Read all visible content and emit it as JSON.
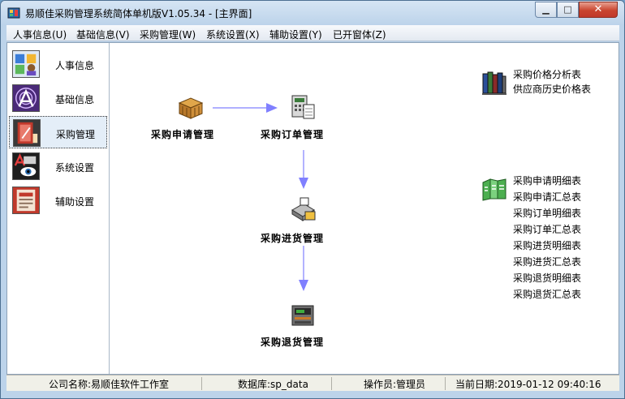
{
  "window": {
    "title": "易顺佳采购管理系统简体单机版V1.05.34 - [主界面]",
    "controls": {
      "minimize": "▁",
      "maximize": "□",
      "close": "✕"
    }
  },
  "menu": [
    {
      "label": "人事信息(U)"
    },
    {
      "label": "基础信息(V)"
    },
    {
      "label": "采购管理(W)"
    },
    {
      "label": "系统设置(X)"
    },
    {
      "label": "辅助设置(Y)"
    },
    {
      "label": "已开窗体(Z)"
    }
  ],
  "sidebar": {
    "items": [
      {
        "label": "人事信息",
        "icon": "people-icon",
        "active": false
      },
      {
        "label": "基础信息",
        "icon": "radar-icon",
        "active": false
      },
      {
        "label": "采购管理",
        "icon": "purchase-icon",
        "active": true
      },
      {
        "label": "系统设置",
        "icon": "settings-icon",
        "active": false
      },
      {
        "label": "辅助设置",
        "icon": "html-doc-icon",
        "active": false
      }
    ]
  },
  "workflow": {
    "request": {
      "label": "采购申请管理",
      "icon": "crate-icon"
    },
    "order": {
      "label": "采购订单管理",
      "icon": "calculator-icon"
    },
    "receive": {
      "label": "采购进货管理",
      "icon": "scanner-icon"
    },
    "returns": {
      "label": "采购退货管理",
      "icon": "register-icon"
    },
    "arrow_color": "#8080ff"
  },
  "reports": {
    "price_group": [
      "采购价格分析表",
      "供应商历史价格表"
    ],
    "detail_group": [
      "采购申请明细表",
      "采购申请汇总表",
      "采购订单明细表",
      "采购订单汇总表",
      "采购进货明细表",
      "采购进货汇总表",
      "采购退货明细表",
      "采购退货汇总表"
    ]
  },
  "status": {
    "company": "公司名称:易顺佳软件工作室",
    "database": "数据库:sp_data",
    "operator": "操作员:管理员",
    "date": "当前日期:2019-01-12 09:40:16"
  }
}
